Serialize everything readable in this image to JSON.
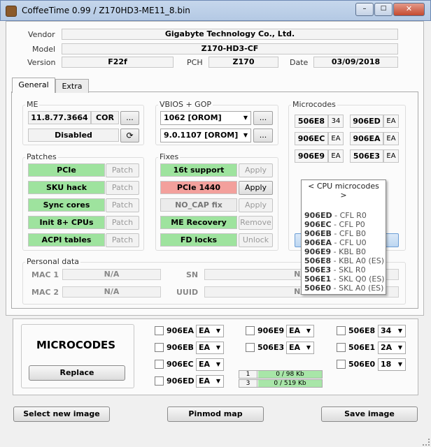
{
  "window": {
    "title": "CoffeeTime 0.99  /  Z170HD3-ME11_8.bin"
  },
  "info": {
    "vendor_label": "Vendor",
    "vendor": "Gigabyte Technology Co., Ltd.",
    "model_label": "Model",
    "model": "Z170-HD3-CF",
    "version_label": "Version",
    "version": "F22f",
    "pch_label": "PCH",
    "pch": "Z170",
    "date_label": "Date",
    "date": "03/09/2018"
  },
  "tabs": [
    {
      "label": "General"
    },
    {
      "label": "Extra"
    }
  ],
  "me": {
    "title": "ME",
    "version": "11.8.77.3664",
    "type": "COR",
    "more": "...",
    "status": "Disabled",
    "refresh_icon": "refresh-icon"
  },
  "vbios": {
    "title": "VBIOS + GOP",
    "vbios": "1062 [OROM]",
    "gop": "9.0.1107 [OROM]",
    "more": "..."
  },
  "patches": {
    "title": "Patches",
    "items": [
      {
        "name": "PCIe",
        "action": "Patch"
      },
      {
        "name": "SKU hack",
        "action": "Patch"
      },
      {
        "name": "Sync cores",
        "action": "Patch"
      },
      {
        "name": "Init 8+ CPUs",
        "action": "Patch"
      },
      {
        "name": "ACPI tables",
        "action": "Patch"
      }
    ]
  },
  "fixes": {
    "title": "Fixes",
    "items": [
      {
        "name": "16t support",
        "action": "Apply",
        "state": "green"
      },
      {
        "name": "PCIe 1440",
        "action": "Apply",
        "state": "red"
      },
      {
        "name": "NO_CAP fix",
        "action": "Apply",
        "state": "gray"
      },
      {
        "name": "ME Recovery",
        "action": "Remove",
        "state": "green"
      },
      {
        "name": "FD locks",
        "action": "Unlock",
        "state": "green"
      }
    ]
  },
  "microcodes": {
    "title": "Microcodes",
    "items": [
      {
        "code": "506E8",
        "ver": "34"
      },
      {
        "code": "906ED",
        "ver": "EA"
      },
      {
        "code": "906EC",
        "ver": "EA"
      },
      {
        "code": "906EA",
        "ver": "EA"
      },
      {
        "code": "906E9",
        "ver": "EA"
      },
      {
        "code": "506E3",
        "ver": "EA"
      }
    ]
  },
  "popup": {
    "header": "< CPU microcodes >",
    "items": [
      {
        "code": "906ED",
        "desc": " - CFL R0"
      },
      {
        "code": "906EC",
        "desc": " - CFL P0"
      },
      {
        "code": "906EB",
        "desc": " - CFL B0"
      },
      {
        "code": "906EA",
        "desc": " - CFL U0"
      },
      {
        "code": "906E9",
        "desc": " - KBL B0"
      },
      {
        "code": "506E8",
        "desc": " - KBL A0 (ES)"
      },
      {
        "code": "506E3",
        "desc": " - SKL R0"
      },
      {
        "code": "506E1",
        "desc": " - SKL Q0 (ES)"
      },
      {
        "code": "506E0",
        "desc": " - SKL A0 (ES)"
      }
    ]
  },
  "personal": {
    "title": "Personal data",
    "mac1_label": "MAC 1",
    "mac1": "N/A",
    "mac2_label": "MAC 2",
    "mac2": "N/A",
    "sn_label": "SN",
    "sn": "N/A",
    "uuid_label": "UUID",
    "uuid": "N/A"
  },
  "bottom": {
    "microcodes_title": "MICROCODES",
    "replace": "Replace",
    "col1": [
      {
        "code": "906EA",
        "ver": "EA"
      },
      {
        "code": "906EB",
        "ver": "EA"
      },
      {
        "code": "906EC",
        "ver": "EA"
      },
      {
        "code": "906ED",
        "ver": "EA"
      }
    ],
    "col2": [
      {
        "code": "906E9",
        "ver": "EA"
      },
      {
        "code": "506E3",
        "ver": "EA"
      }
    ],
    "col3": [
      {
        "code": "506E8",
        "ver": "34"
      },
      {
        "code": "506E1",
        "ver": "2A"
      },
      {
        "code": "506E0",
        "ver": "18"
      }
    ],
    "progress": [
      {
        "id": "1",
        "text": "0 / 98 Kb"
      },
      {
        "id": "3",
        "text": "0 / 519 Kb"
      }
    ]
  },
  "actions": {
    "select": "Select new image",
    "pinmod": "Pinmod map",
    "save": "Save image"
  },
  "colors": {
    "green": "#9ee39e",
    "red": "#f3a09c",
    "title_bar": "#b9cde6"
  }
}
